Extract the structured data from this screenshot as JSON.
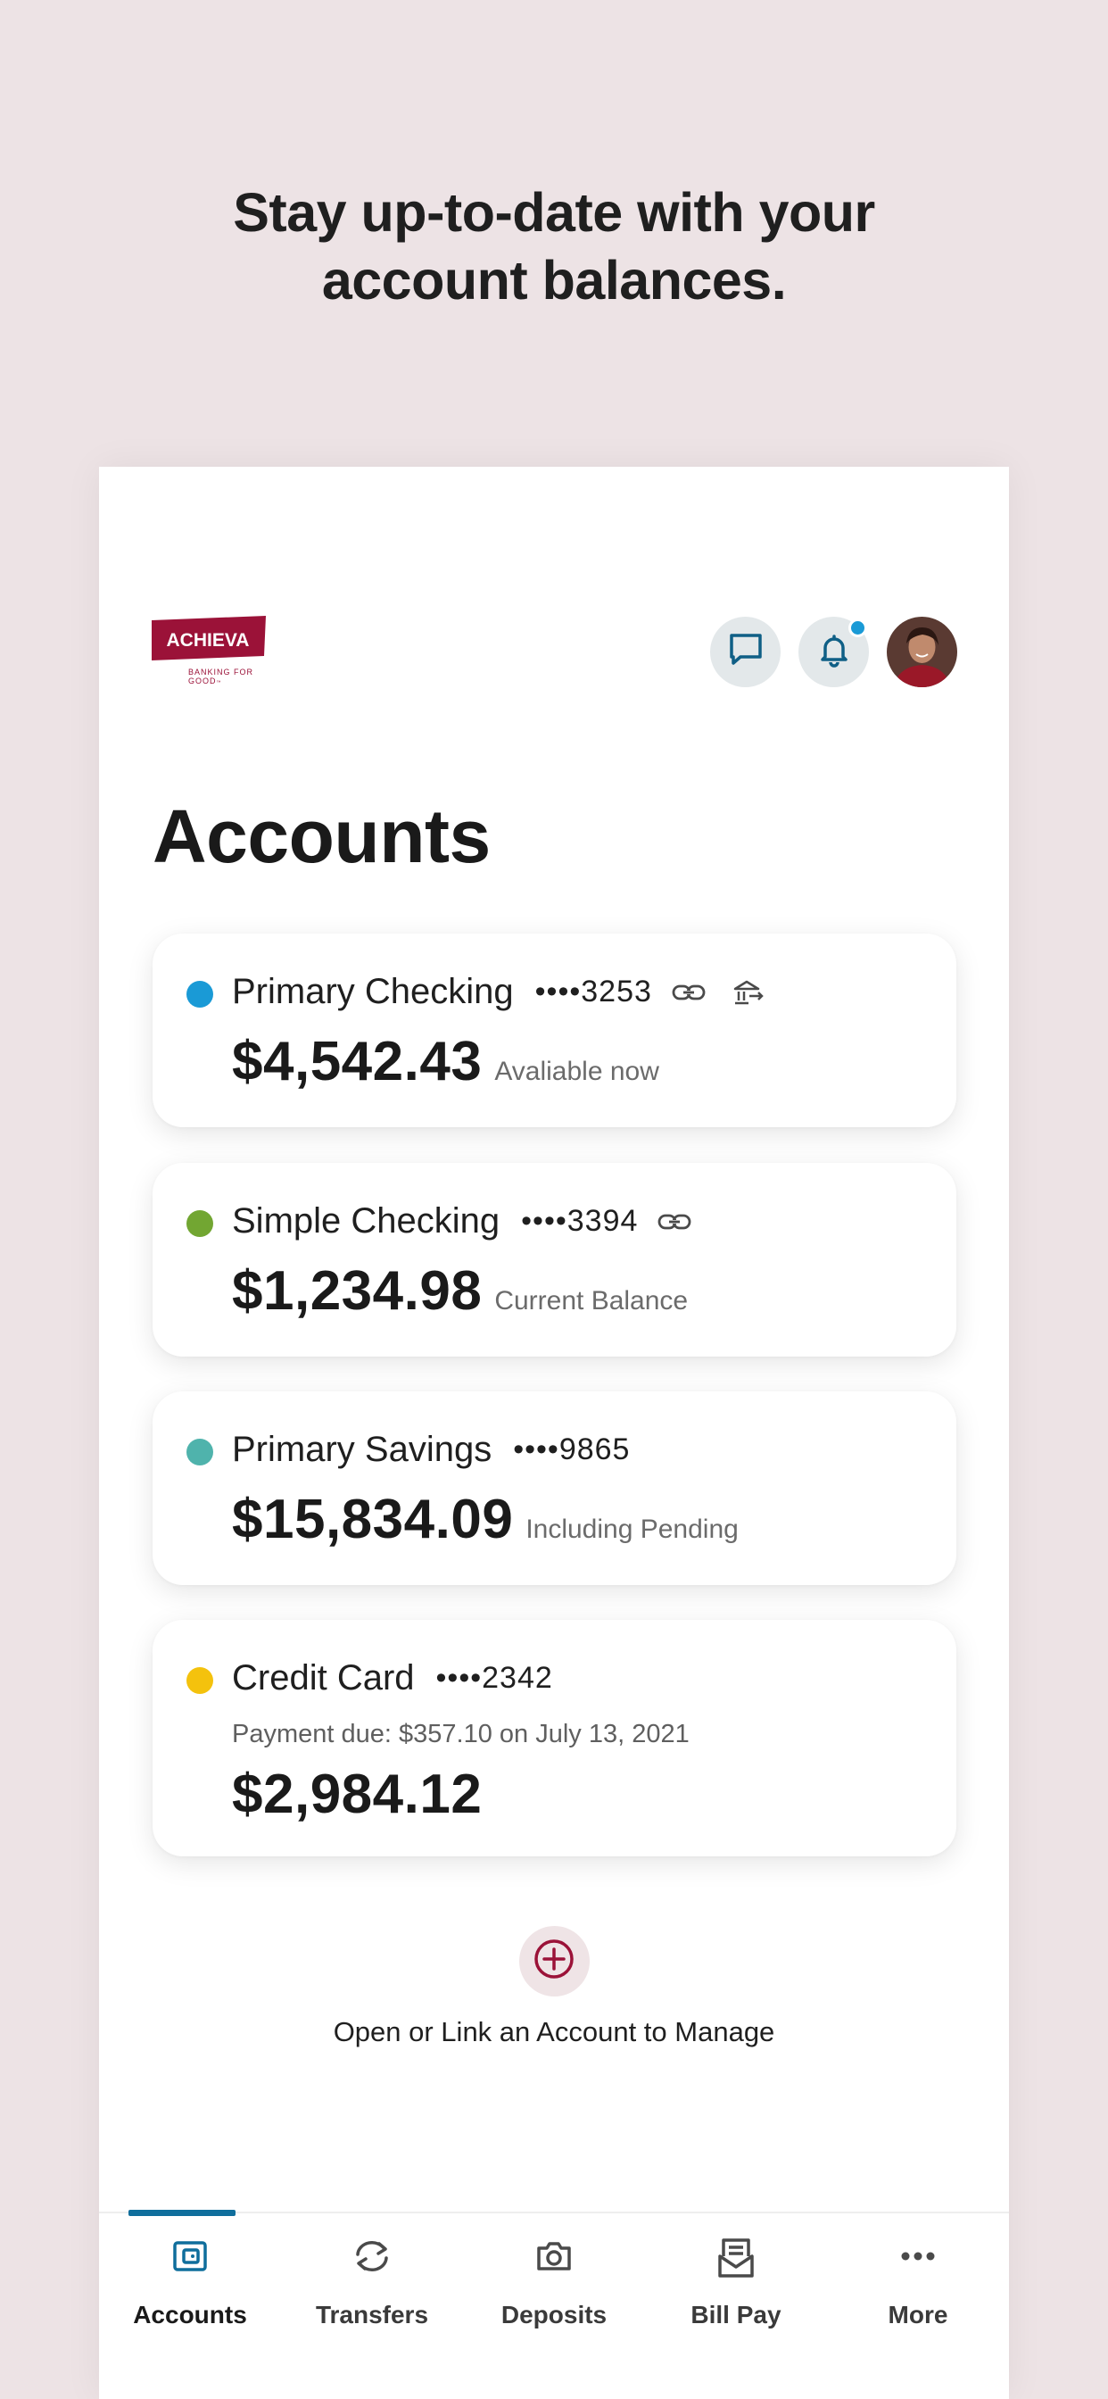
{
  "promo": {
    "headline_line1": "Stay up-to-date with your",
    "headline_line2": "account balances."
  },
  "header": {
    "logo_text": "ACHIEVA",
    "logo_tagline_1": "BANKING FOR",
    "logo_tagline_2": "GOOD",
    "logo_trademark": "™",
    "icons": [
      "chat-icon",
      "bell-icon",
      "avatar"
    ]
  },
  "page_title": "Accounts",
  "accounts": [
    {
      "name": "Primary Checking",
      "mask": "••••3253",
      "amount": "$4,542.43",
      "sub": "Avaliable now",
      "dot_color": "#1a9ad6"
    },
    {
      "name": "Simple Checking",
      "mask": "••••3394",
      "amount": "$1,234.98",
      "sub": "Current Balance",
      "dot_color": "#72a632"
    },
    {
      "name": "Primary Savings",
      "mask": "••••9865",
      "amount": "$15,834.09",
      "sub": "Including Pending",
      "dot_color": "#4fb3ac"
    },
    {
      "name": "Credit Card",
      "mask": "••••2342",
      "due": "Payment due: $357.10 on July 13, 2021",
      "amount": "$2,984.12",
      "dot_color": "#f4c20d"
    }
  ],
  "add_account": {
    "label": "Open or Link an Account to Manage"
  },
  "tabs": [
    {
      "label": "Accounts",
      "icon": "wallet-icon",
      "active": true
    },
    {
      "label": "Transfers",
      "icon": "transfer-icon",
      "active": false
    },
    {
      "label": "Deposits",
      "icon": "camera-icon",
      "active": false
    },
    {
      "label": "Bill Pay",
      "icon": "bill-icon",
      "active": false
    },
    {
      "label": "More",
      "icon": "more-icon",
      "active": false
    }
  ],
  "colors": {
    "background": "#ede3e5",
    "brand": "#9b1238",
    "accent": "#0f6e9c"
  }
}
